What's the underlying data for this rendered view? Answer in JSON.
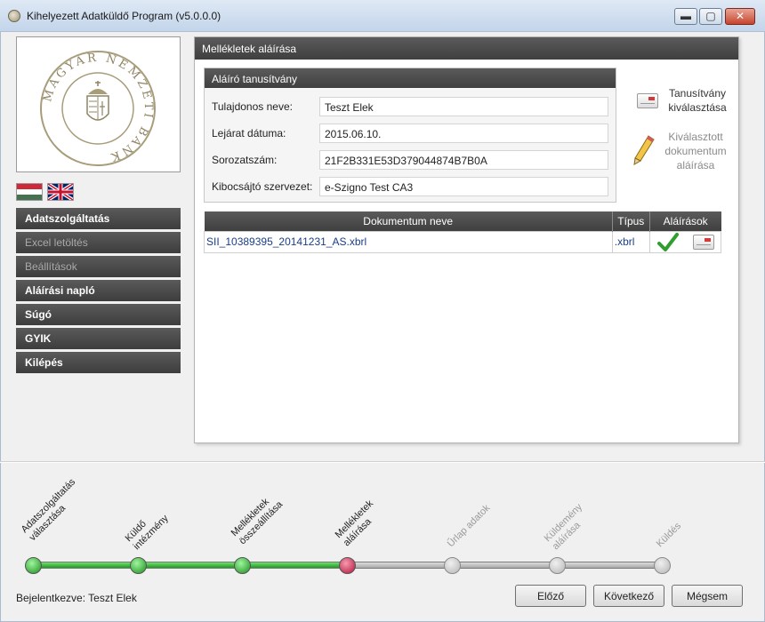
{
  "window": {
    "title": "Kihelyezett Adatküldő Program (v5.0.0.0)",
    "minimize_glyph": "▬",
    "maximize_glyph": "▢",
    "close_glyph": "✕"
  },
  "logo": {
    "text": "MAGYAR NEMZETI BANK"
  },
  "languages": [
    "hu-flag-icon",
    "gb-flag-icon"
  ],
  "menu": {
    "items": [
      {
        "label": "Adatszolgáltatás",
        "enabled": true
      },
      {
        "label": "Excel letöltés",
        "enabled": false
      },
      {
        "label": "Beállítások",
        "enabled": false
      },
      {
        "label": "Aláírási napló",
        "enabled": true
      },
      {
        "label": "Súgó",
        "enabled": true
      },
      {
        "label": "GYIK",
        "enabled": true
      },
      {
        "label": "Kilépés",
        "enabled": true
      }
    ]
  },
  "main": {
    "header": "Mellékletek aláírása",
    "certificate": {
      "header": "Aláíró tanusítvány",
      "fields": [
        {
          "label": "Tulajdonos neve:",
          "value": "Teszt Elek"
        },
        {
          "label": "Lejárat dátuma:",
          "value": "2015.06.10."
        },
        {
          "label": "Sorozatszám:",
          "value": "21F2B331E53D379044874B7B0A"
        },
        {
          "label": "Kibocsájtó szervezet:",
          "value": "e-Szigno Test CA3"
        }
      ]
    },
    "select_cert_button": {
      "line1": "Tanusítvány",
      "line2": "kiválasztása"
    },
    "sign_doc_button": {
      "line1": "Kiválasztott",
      "line2": "dokumentum",
      "line3": "aláírása"
    },
    "table": {
      "columns": [
        "Dokumentum neve",
        "Típus",
        "Aláírások"
      ],
      "rows": [
        {
          "name": "SII_10389395_20141231_AS.xbrl",
          "type": ".xbrl",
          "signed": true
        }
      ]
    }
  },
  "steps": [
    {
      "label": "Adatszolgáltatás\nválasztása",
      "state": "done"
    },
    {
      "label": "Küldő\nintézmény",
      "state": "done"
    },
    {
      "label": "Mellékletek\nösszeállítása",
      "state": "done"
    },
    {
      "label": "Mellékletek\naláírása",
      "state": "current"
    },
    {
      "label": "Űrlap adatok",
      "state": "todo"
    },
    {
      "label": "Küldemény\naláírása",
      "state": "todo"
    },
    {
      "label": "Küldés",
      "state": "todo"
    }
  ],
  "status": {
    "logged_in_label": "Bejelentkezve:",
    "user": "Teszt Elek"
  },
  "buttons": {
    "prev": "Előző",
    "next": "Következő",
    "cancel": "Mégsem"
  },
  "colors": {
    "header_dark": "#4a4a4a",
    "step_done": "#1f9a1f",
    "step_current": "#b4123a",
    "link_blue": "#1a3d8a"
  }
}
